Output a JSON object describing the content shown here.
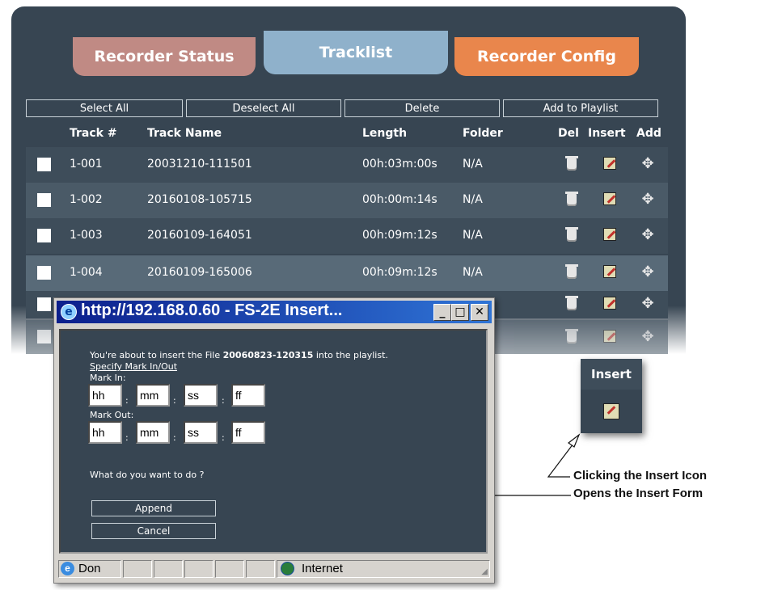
{
  "tabs": [
    {
      "label": "Recorder Status"
    },
    {
      "label": "Tracklist"
    },
    {
      "label": "Recorder Config"
    }
  ],
  "toolbar": {
    "select_all": "Select All",
    "deselect_all": "Deselect All",
    "delete": "Delete",
    "add_to_playlist": "Add to Playlist"
  },
  "table": {
    "headers": {
      "track_num": "Track #",
      "track_name": "Track Name",
      "length": "Length",
      "folder": "Folder",
      "del": "Del",
      "insert": "Insert",
      "add": "Add"
    },
    "rows": [
      {
        "track": "1-001",
        "name": "20031210-111501",
        "length": "00h:03m:00s",
        "folder": "N/A"
      },
      {
        "track": "1-002",
        "name": "20160108-105715",
        "length": "00h:00m:14s",
        "folder": "N/A"
      },
      {
        "track": "1-003",
        "name": "20160109-164051",
        "length": "00h:09m:12s",
        "folder": "N/A"
      },
      {
        "track": "1-004",
        "name": "20160109-165006",
        "length": "00h:09m:12s",
        "folder": "N/A"
      }
    ]
  },
  "callout": {
    "header": "Insert"
  },
  "annotations": {
    "line1": "Clicking the Insert Icon",
    "line2": "Opens the Insert Form"
  },
  "dialog": {
    "title": "http://192.168.0.60 - FS-2E  Insert...",
    "message_prefix": "You're about to insert the File ",
    "file_name": "20060823-120315",
    "message_suffix": " into the playlist.",
    "specify_link": "Specify Mark In/Out",
    "mark_in_label": "Mark In:",
    "mark_out_label": "Mark Out:",
    "fields": {
      "hh": "hh",
      "mm": "mm",
      "ss": "ss",
      "ff": "ff"
    },
    "question": "What do you want to do ?",
    "append": "Append",
    "cancel": "Cancel",
    "status_done": "Don",
    "status_zone": "Internet"
  }
}
